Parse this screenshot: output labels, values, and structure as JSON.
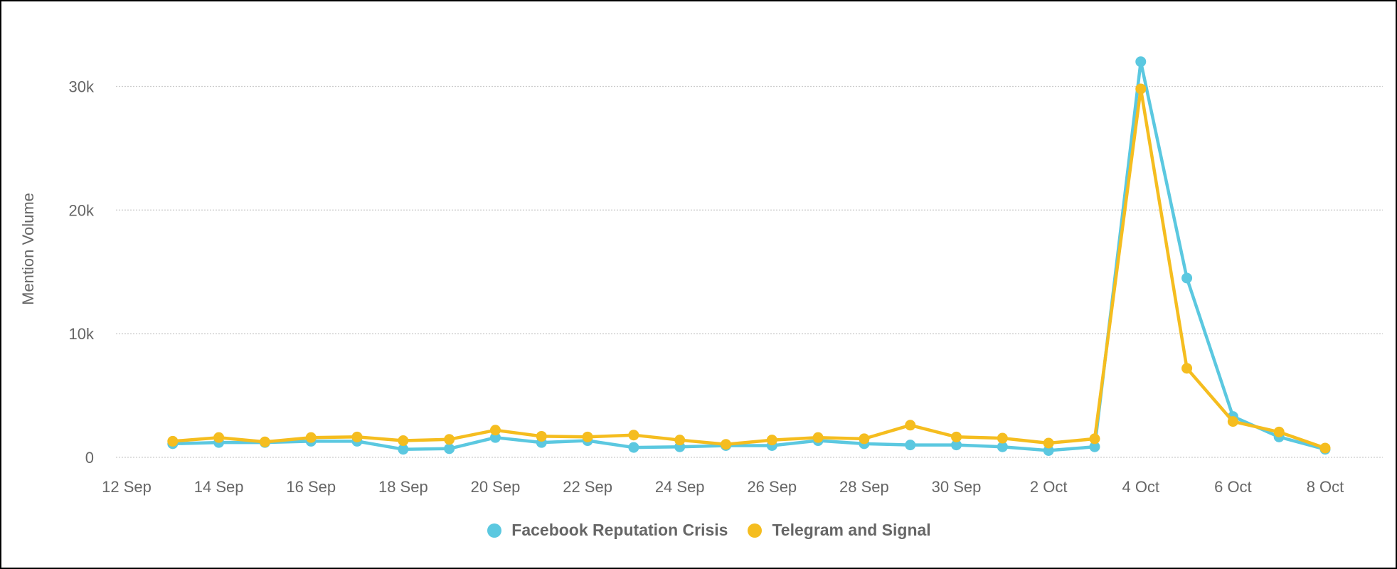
{
  "chart_data": {
    "type": "line",
    "title": "",
    "xlabel": "",
    "ylabel": "Mention Volume",
    "ylim": [
      0,
      35000
    ],
    "grid": true,
    "legend_position": "bottom-center",
    "y_ticks": [
      {
        "value": 0,
        "label": "0"
      },
      {
        "value": 10000,
        "label": "10k"
      },
      {
        "value": 20000,
        "label": "20k"
      },
      {
        "value": 30000,
        "label": "30k"
      }
    ],
    "x_ticks": [
      {
        "day": 0,
        "label": "12 Sep"
      },
      {
        "day": 2,
        "label": "14 Sep"
      },
      {
        "day": 4,
        "label": "16 Sep"
      },
      {
        "day": 6,
        "label": "18 Sep"
      },
      {
        "day": 8,
        "label": "20 Sep"
      },
      {
        "day": 10,
        "label": "22 Sep"
      },
      {
        "day": 12,
        "label": "24 Sep"
      },
      {
        "day": 14,
        "label": "26 Sep"
      },
      {
        "day": 16,
        "label": "28 Sep"
      },
      {
        "day": 18,
        "label": "30 Sep"
      },
      {
        "day": 20,
        "label": "2 Oct"
      },
      {
        "day": 22,
        "label": "4 Oct"
      },
      {
        "day": 24,
        "label": "6 Oct"
      },
      {
        "day": 26,
        "label": "8 Oct"
      }
    ],
    "x_range_days": [
      0,
      26
    ],
    "x": [
      "13 Sep",
      "14 Sep",
      "15 Sep",
      "16 Sep",
      "17 Sep",
      "18 Sep",
      "19 Sep",
      "20 Sep",
      "21 Sep",
      "22 Sep",
      "23 Sep",
      "24 Sep",
      "25 Sep",
      "26 Sep",
      "27 Sep",
      "28 Sep",
      "29 Sep",
      "30 Sep",
      "1 Oct",
      "2 Oct",
      "3 Oct",
      "4 Oct",
      "5 Oct",
      "6 Oct",
      "7 Oct",
      "8 Oct"
    ],
    "x_days": [
      1,
      2,
      3,
      4,
      5,
      6,
      7,
      8,
      9,
      10,
      11,
      12,
      13,
      14,
      15,
      16,
      17,
      18,
      19,
      20,
      21,
      22,
      23,
      24,
      25,
      26
    ],
    "series": [
      {
        "name": "Facebook Reputation Crisis",
        "color": "#5bc8e0",
        "values": [
          1100,
          1200,
          1200,
          1300,
          1300,
          650,
          700,
          1600,
          1200,
          1350,
          800,
          850,
          950,
          950,
          1350,
          1100,
          1000,
          1000,
          850,
          550,
          850,
          32000,
          14500,
          3300,
          1650,
          650
        ]
      },
      {
        "name": "Telegram and Signal",
        "color": "#f5bd1f",
        "values": [
          1300,
          1600,
          1250,
          1600,
          1650,
          1350,
          1450,
          2200,
          1700,
          1650,
          1800,
          1400,
          1050,
          1400,
          1600,
          1500,
          2600,
          1650,
          1550,
          1150,
          1500,
          29800,
          7200,
          2900,
          2050,
          750
        ]
      }
    ]
  },
  "legend": {
    "items": [
      {
        "label": "Facebook Reputation Crisis",
        "color": "#5bc8e0"
      },
      {
        "label": "Telegram and Signal",
        "color": "#f5bd1f"
      }
    ]
  }
}
